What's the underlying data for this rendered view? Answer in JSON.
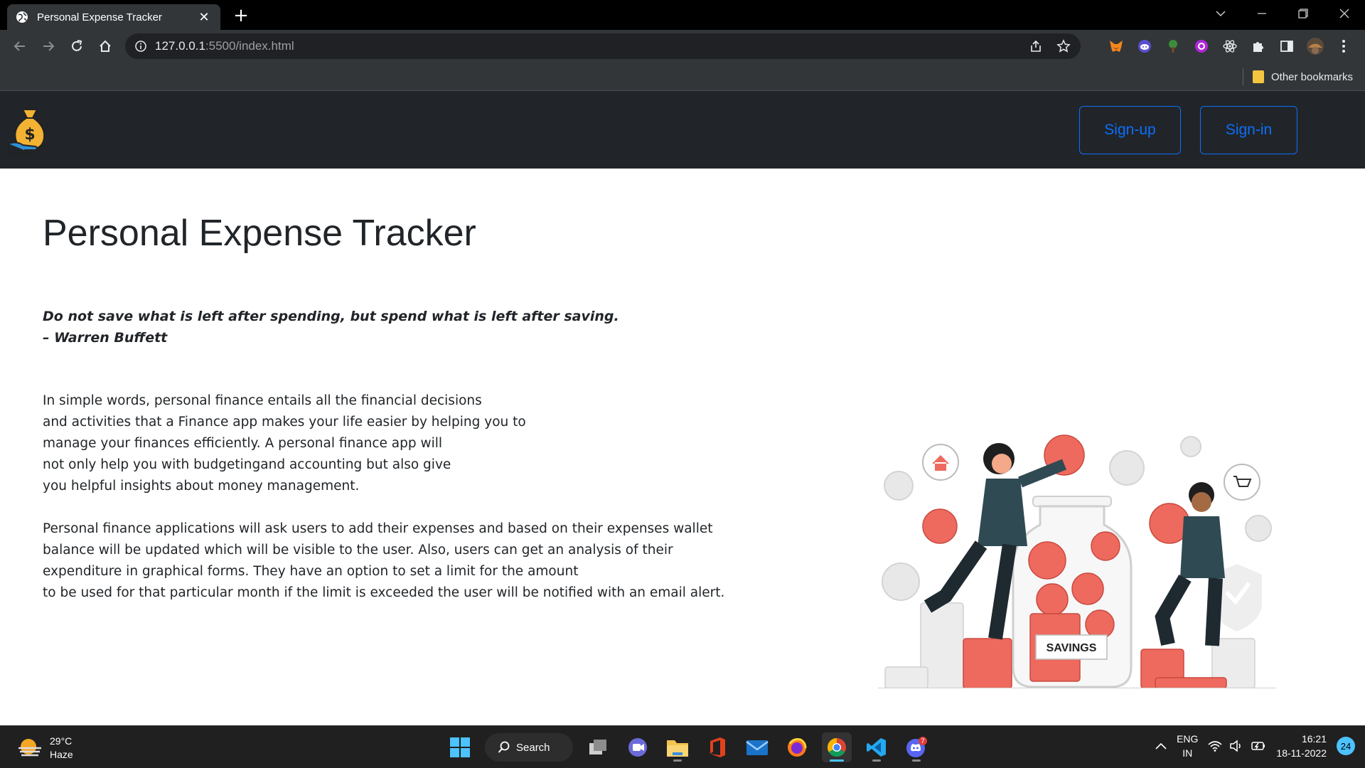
{
  "browser": {
    "tab": {
      "title": "Personal Expense Tracker",
      "close_glyph": "✕"
    },
    "new_tab_glyph": "+",
    "url": {
      "host": "127.0.0.1",
      "rest": ":5500/index.html"
    },
    "bookmarks": {
      "other": "Other bookmarks"
    }
  },
  "navbar": {
    "signup_label": "Sign-up",
    "signin_label": "Sign-in"
  },
  "main": {
    "title": "Personal Expense Tracker",
    "quote_line1": "Do not save what is left after spending, but spend what is left after saving.",
    "quote_line2": "– Warren Buffett",
    "para1": [
      "In simple words, personal finance entails all the financial decisions",
      "and activities that a Finance app makes your life easier by helping you to",
      "manage your finances efficiently. A personal finance app will",
      "not only help you with budgetingand accounting but also give",
      "you helpful insights about money management."
    ],
    "para2": [
      "Personal finance applications will ask users to add their expenses and based on their expenses wallet",
      "balance will be updated which will be visible to the user. Also, users can get an analysis of their",
      "expenditure in graphical forms. They have an option to set a limit for the amount",
      "to be used for that particular month if the limit is exceeded the user will be notified with an email alert."
    ],
    "illustration_label": "SAVINGS"
  },
  "taskbar": {
    "weather": {
      "temp": "29°C",
      "condition": "Haze"
    },
    "search_label": "Search",
    "discord_badge": "7",
    "lang": {
      "line1": "ENG",
      "line2": "IN"
    },
    "clock": {
      "time": "16:21",
      "date": "18-11-2022"
    },
    "notification_count": "24"
  },
  "colors": {
    "accent": "#0d6efd",
    "navbar_bg": "#212529",
    "coin": "#f0645a"
  }
}
